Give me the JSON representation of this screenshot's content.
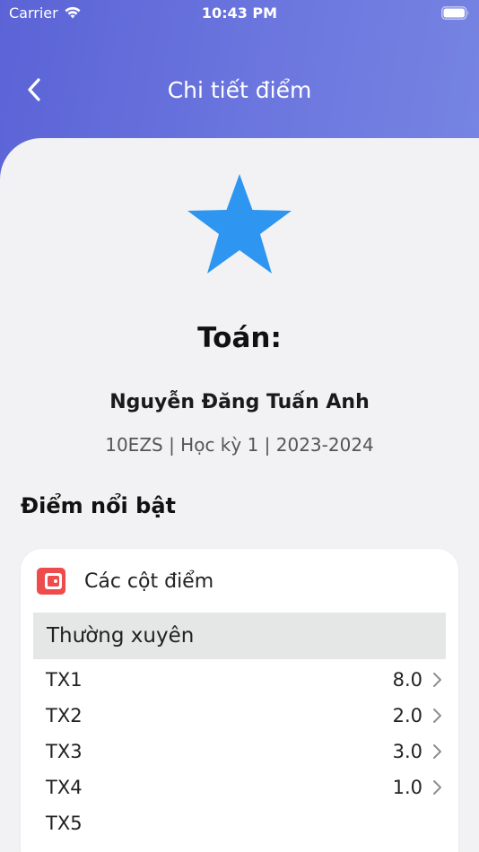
{
  "status_bar": {
    "carrier": "Carrier",
    "time": "10:43 PM"
  },
  "nav": {
    "title": "Chi tiết điểm"
  },
  "subject": {
    "title": "Toán:"
  },
  "student": {
    "name": "Nguyễn Đăng Tuấn Anh",
    "info": "10EZS | Học kỳ 1 | 2023-2024"
  },
  "section": {
    "heading": "Điểm nổi bật"
  },
  "card": {
    "title": "Các cột điểm",
    "group": "Thường xuyên",
    "rows": [
      {
        "label": "TX1",
        "value": "8.0"
      },
      {
        "label": "TX2",
        "value": "2.0"
      },
      {
        "label": "TX3",
        "value": "3.0"
      },
      {
        "label": "TX4",
        "value": "1.0"
      },
      {
        "label": "TX5",
        "value": ""
      }
    ]
  },
  "colors": {
    "accent": "#5b63d6",
    "star": "#2e96f0",
    "wallet": "#ee4c4c"
  },
  "icons": [
    "wifi-icon",
    "battery-icon",
    "back-chevron-icon",
    "star-icon",
    "wallet-icon",
    "chevron-right-icon"
  ]
}
